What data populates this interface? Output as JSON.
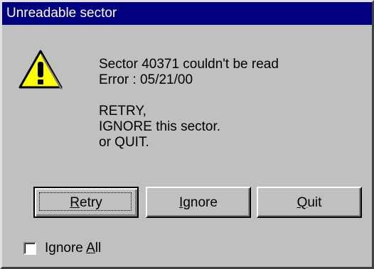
{
  "window": {
    "title": "Unreadable sector"
  },
  "message": {
    "line1": "Sector 40371 couldn't be read",
    "line2": "Error : 05/21/00",
    "line3": "RETRY,",
    "line4": "IGNORE this sector.",
    "line5": "or QUIT."
  },
  "icon": {
    "name": "warning-icon",
    "fill_color": "#ffff00"
  },
  "buttons": {
    "retry": {
      "prefix": "",
      "accel": "R",
      "rest": "etry"
    },
    "ignore": {
      "prefix": "",
      "accel": "I",
      "rest": "gnore"
    },
    "quit": {
      "prefix": "",
      "accel": "Q",
      "rest": "uit"
    }
  },
  "ignore_all": {
    "prefix": "Ignore ",
    "accel": "A",
    "rest": "ll",
    "checked": false
  },
  "colors": {
    "titlebar": "#000080",
    "dialog_bg": "#c0c0c0"
  }
}
